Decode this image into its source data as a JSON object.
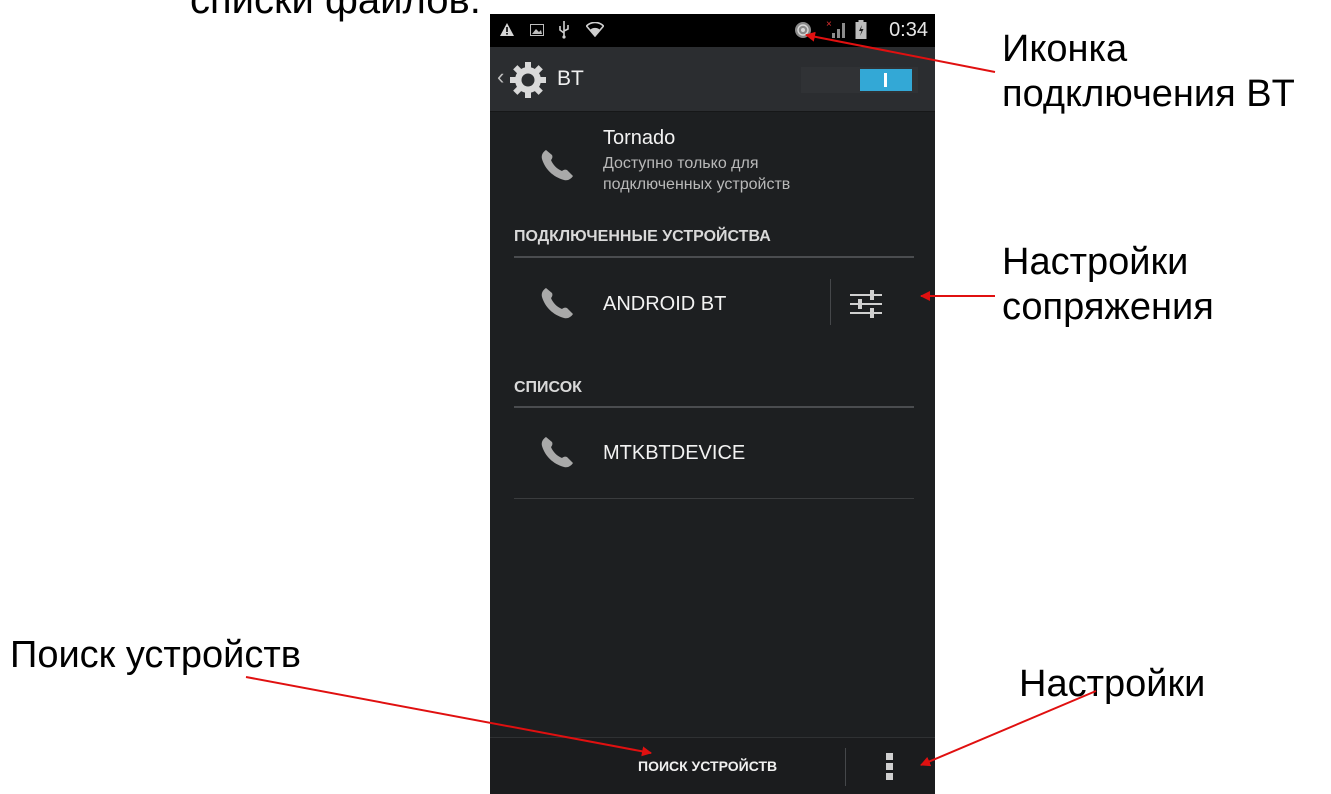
{
  "slide": {
    "title": "списки файлов."
  },
  "annotations": {
    "bt_icon": [
      "Иконка",
      "подключения BT"
    ],
    "pairing": [
      "Настройки",
      "сопряжения"
    ],
    "search": "Поиск устройств",
    "settings": "Настройки"
  },
  "status_bar": {
    "time": "0:34",
    "icons": [
      "warning-icon",
      "image-icon",
      "usb-icon",
      "wifi-icon",
      "bluetooth-connected-icon",
      "signal-icon",
      "battery-icon"
    ]
  },
  "action_bar": {
    "title": "BT",
    "toggle_on": true,
    "accent": "#33a8d6"
  },
  "this_device": {
    "name": "Tornado",
    "visibility": "Доступно только для подключенных устройств",
    "visibility_line1": "Доступно только для",
    "visibility_line2": "подключенных устройств"
  },
  "connected": {
    "header": "ПОДКЛЮЧЕННЫЕ УСТРОЙСТВА",
    "devices": [
      {
        "name": "ANDROID BT",
        "icon": "phone-icon"
      }
    ]
  },
  "list": {
    "header": "СПИСОК",
    "devices": [
      {
        "name": "MTKBTDEVICE",
        "icon": "phone-icon"
      }
    ]
  },
  "bottom_bar": {
    "search_label": "ПОИСК УСТРОЙСТВ"
  }
}
